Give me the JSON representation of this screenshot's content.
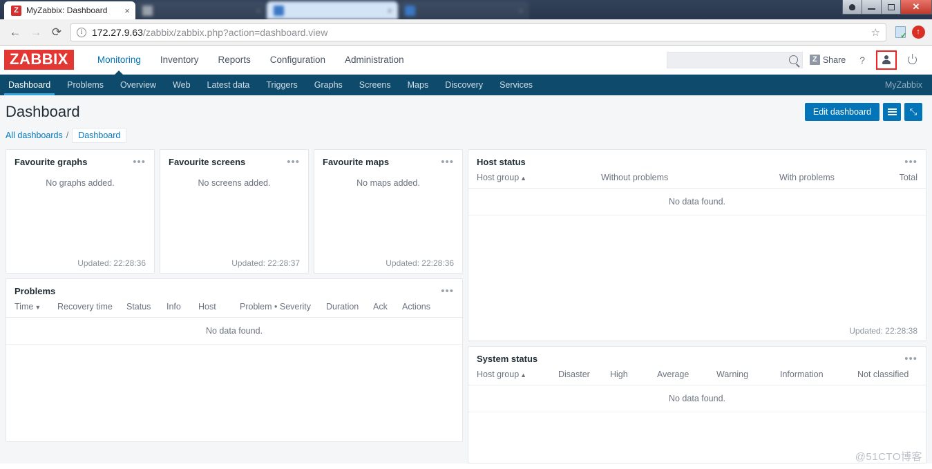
{
  "browser": {
    "tabs": [
      {
        "title": "MyZabbix: Dashboard",
        "favicon": "zabbix-favicon",
        "favicon_letter": "Z",
        "state": "active",
        "blurred": false
      },
      {
        "title": "",
        "favicon": "generic-favicon",
        "favicon_letter": "",
        "state": "inactive",
        "blurred": true
      },
      {
        "title": "",
        "favicon": "generic-favicon",
        "favicon_letter": "",
        "state": "inactive",
        "blurred": true
      },
      {
        "title": "",
        "favicon": "generic-favicon",
        "favicon_letter": "",
        "state": "inactive",
        "blurred": true
      }
    ],
    "tab_close_label": "×",
    "window_controls": {
      "user": "user-account-icon",
      "minimize": "minimize-icon",
      "restore": "restore-icon",
      "close": "✕"
    },
    "toolbar": {
      "back": "←",
      "forward": "→",
      "reload": "⟳",
      "url_host": "172.27.9.63",
      "url_path": "/zabbix/zabbix.php?action=dashboard.view",
      "url_full": "172.27.9.63/zabbix/zabbix.php?action=dashboard.view",
      "info_glyph": "i",
      "bookmark_star": "☆"
    }
  },
  "zabbix": {
    "logo": "ZABBIX",
    "main_menu": [
      {
        "label": "Monitoring",
        "active": true
      },
      {
        "label": "Inventory",
        "active": false
      },
      {
        "label": "Reports",
        "active": false
      },
      {
        "label": "Configuration",
        "active": false
      },
      {
        "label": "Administration",
        "active": false
      }
    ],
    "search": {
      "value": "",
      "placeholder": ""
    },
    "header_actions": {
      "share_label": "Share",
      "share_badge": "Z",
      "help_label": "?",
      "user_icon": "user-profile-icon",
      "signout_icon": "power-signout-icon"
    },
    "subnav": [
      {
        "label": "Dashboard",
        "active": true
      },
      {
        "label": "Problems",
        "active": false
      },
      {
        "label": "Overview",
        "active": false
      },
      {
        "label": "Web",
        "active": false
      },
      {
        "label": "Latest data",
        "active": false
      },
      {
        "label": "Triggers",
        "active": false
      },
      {
        "label": "Graphs",
        "active": false
      },
      {
        "label": "Screens",
        "active": false
      },
      {
        "label": "Maps",
        "active": false
      },
      {
        "label": "Discovery",
        "active": false
      },
      {
        "label": "Services",
        "active": false
      }
    ],
    "subnav_user": "MyZabbix"
  },
  "page": {
    "title": "Dashboard",
    "edit_button": "Edit dashboard",
    "menu_icon": "hamburger-menu-icon",
    "fullscreen_icon": "⤡",
    "breadcrumb": {
      "root": "All dashboards",
      "separator": "/",
      "current": "Dashboard"
    }
  },
  "widgets": {
    "favourite_graphs": {
      "title": "Favourite graphs",
      "empty": "No graphs added.",
      "updated": "Updated: 22:28:36",
      "menu": "•••"
    },
    "favourite_screens": {
      "title": "Favourite screens",
      "empty": "No screens added.",
      "updated": "Updated: 22:28:37",
      "menu": "•••"
    },
    "favourite_maps": {
      "title": "Favourite maps",
      "empty": "No maps added.",
      "updated": "Updated: 22:28:36",
      "menu": "•••"
    },
    "problems": {
      "title": "Problems",
      "columns": [
        "Time",
        "Recovery time",
        "Status",
        "Info",
        "Host",
        "Problem • Severity",
        "Duration",
        "Ack",
        "Actions"
      ],
      "sort_column": "Time",
      "sort_direction": "▼",
      "empty": "No data found.",
      "menu": "•••"
    },
    "host_status": {
      "title": "Host status",
      "columns": [
        "Host group",
        "Without problems",
        "With problems",
        "Total"
      ],
      "sort_column": "Host group",
      "sort_direction": "▲",
      "empty": "No data found.",
      "updated": "Updated: 22:28:38",
      "menu": "•••"
    },
    "system_status": {
      "title": "System status",
      "columns": [
        "Host group",
        "Disaster",
        "High",
        "Average",
        "Warning",
        "Information",
        "Not classified"
      ],
      "sort_column": "Host group",
      "sort_direction": "▲",
      "empty": "No data found.",
      "menu": "•••"
    }
  },
  "watermark": "@51CTO博客",
  "colors": {
    "zabbix_red": "#e33734",
    "nav_dark_blue": "#0e4a6b",
    "accent_blue": "#0275b8",
    "active_tab_underline": "#3ba3dd",
    "highlight_box": "#ee2222",
    "page_bg": "#f4f6f8"
  }
}
